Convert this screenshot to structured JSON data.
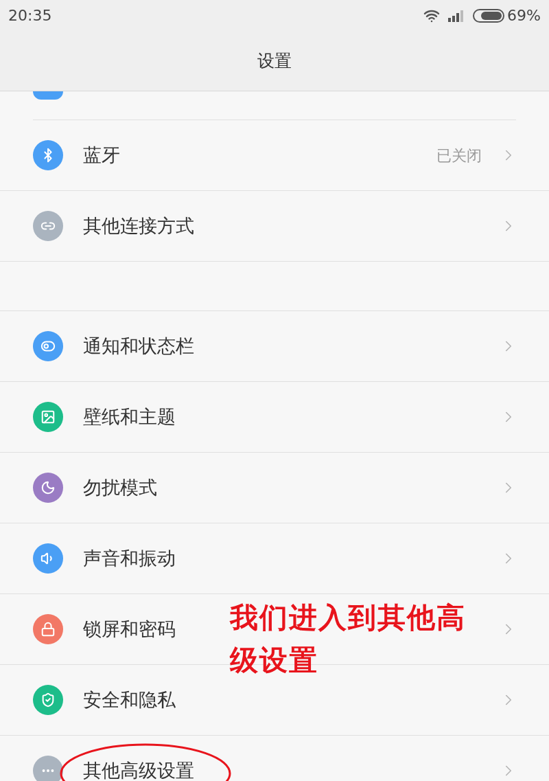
{
  "status_bar": {
    "time": "20:35",
    "battery": "69%"
  },
  "header": {
    "title": "设置"
  },
  "sections": [
    {
      "items": [
        {
          "label": "蓝牙",
          "value": "已关闭"
        },
        {
          "label": "其他连接方式"
        }
      ]
    },
    {
      "items": [
        {
          "label": "通知和状态栏"
        },
        {
          "label": "壁纸和主题"
        },
        {
          "label": "勿扰模式"
        },
        {
          "label": "声音和振动"
        },
        {
          "label": "锁屏和密码"
        },
        {
          "label": "安全和隐私"
        },
        {
          "label": "其他高级设置"
        }
      ]
    }
  ],
  "annotation": {
    "text": "我们进入到其他高级设置"
  }
}
